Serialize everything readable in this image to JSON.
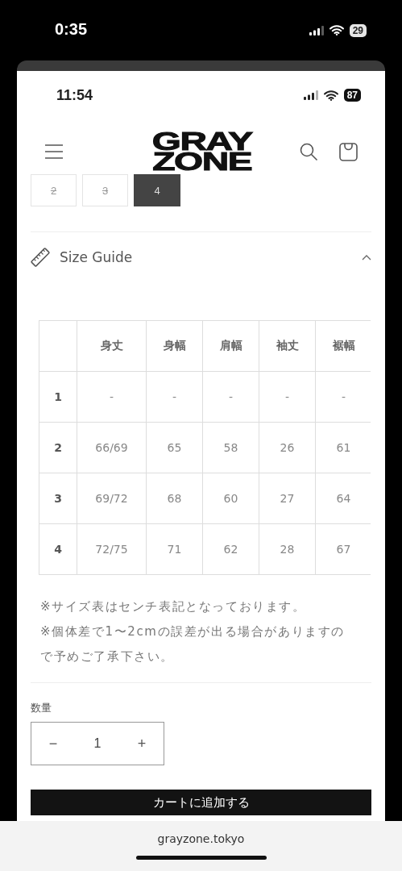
{
  "outer_status": {
    "time": "0:35",
    "battery": "29"
  },
  "inner_status": {
    "time": "11:54",
    "battery": "87"
  },
  "header": {
    "logo": [
      "GRAY",
      "ZONE"
    ]
  },
  "sizes": [
    {
      "label": "2",
      "selected": false,
      "sold_out": true
    },
    {
      "label": "3",
      "selected": false,
      "sold_out": true
    },
    {
      "label": "4",
      "selected": true,
      "sold_out": false
    }
  ],
  "size_guide": {
    "title": "Size Guide",
    "expanded": true,
    "table": {
      "columns": [
        "身丈",
        "身幅",
        "肩幅",
        "袖丈",
        "裾幅"
      ],
      "rows": [
        {
          "size": "1",
          "cells": [
            "-",
            "-",
            "-",
            "-",
            "-"
          ]
        },
        {
          "size": "2",
          "cells": [
            "66/69",
            "65",
            "58",
            "26",
            "61"
          ]
        },
        {
          "size": "3",
          "cells": [
            "69/72",
            "68",
            "60",
            "27",
            "64"
          ]
        },
        {
          "size": "4",
          "cells": [
            "72/75",
            "71",
            "62",
            "28",
            "67"
          ]
        }
      ]
    },
    "notes": [
      "※サイズ表はセンチ表記となっております。",
      "※個体差で1〜2cmの誤差が出る場合がありますので予めご了承下さい。"
    ]
  },
  "quantity": {
    "label": "数量",
    "minus": "−",
    "value": "1",
    "plus": "+"
  },
  "cart_button": {
    "label": "カートに追加する"
  },
  "browser_bar": {
    "url": "grayzone.tokyo"
  }
}
